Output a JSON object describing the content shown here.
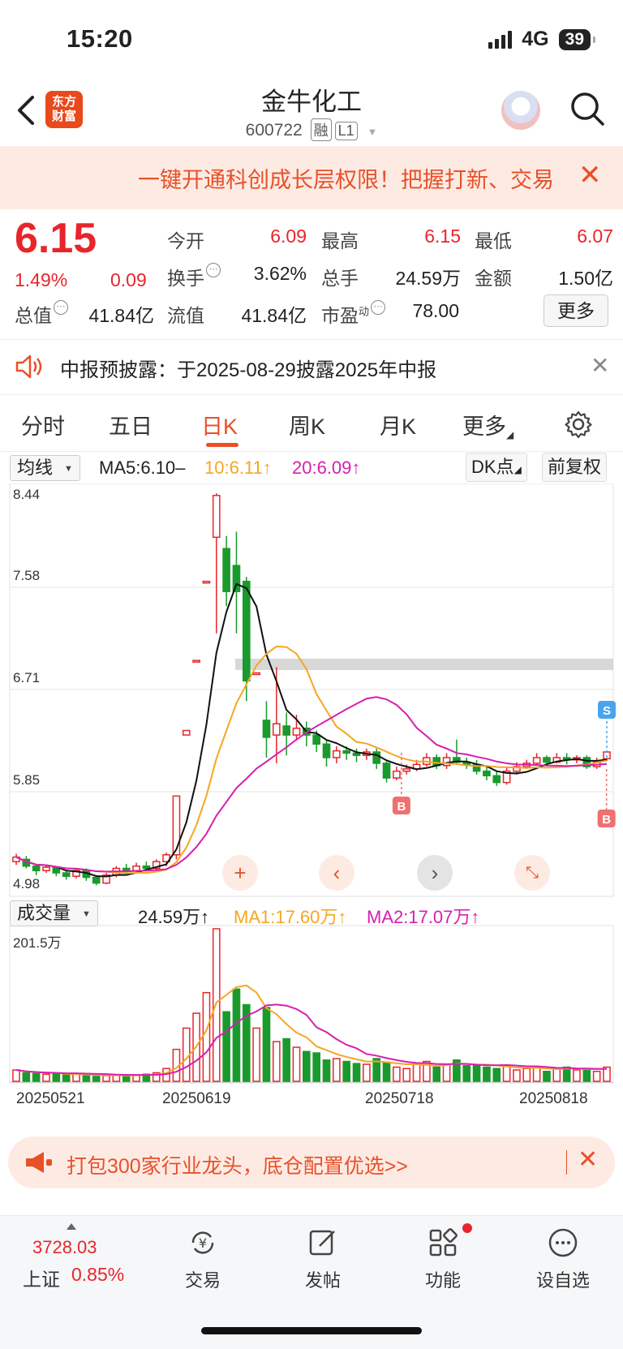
{
  "status": {
    "time": "15:20",
    "network": "4G",
    "battery": "39"
  },
  "header": {
    "logo_line1": "东方",
    "logo_line2": "财富",
    "name": "金牛化工",
    "code": "600722",
    "tag1": "融",
    "tag2": "L1"
  },
  "top_banner": {
    "text": "一键开通科创成长层权限！把握打新、交易",
    "close": "✕"
  },
  "quote": {
    "price": "6.15",
    "change_pct": "1.49%",
    "change_amt": "0.09",
    "open_label": "今开",
    "open": "6.09",
    "high_label": "最高",
    "high": "6.15",
    "low_label": "最低",
    "low": "6.07",
    "turnover_label": "换手",
    "turnover": "3.62%",
    "volume_label": "总手",
    "volume": "24.59万",
    "amount_label": "金额",
    "amount": "1.50亿",
    "mktcap_label": "总值",
    "mktcap": "41.84亿",
    "float_label": "流值",
    "float": "41.84亿",
    "pe_label": "市盈",
    "pe_sup": "动",
    "pe": "78.00",
    "more": "更多"
  },
  "notice": {
    "text": "中报预披露：于2025-08-29披露2025年中报",
    "close": "✕"
  },
  "tabs": [
    "分时",
    "五日",
    "日K",
    "周K",
    "月K",
    "更多"
  ],
  "ma_bar": {
    "selector": "均线",
    "ma5": "MA5:6.10–",
    "ma10": "10:6.11↑",
    "ma20": "20:6.09↑",
    "dk": "DK点",
    "adj": "前复权"
  },
  "vol_bar": {
    "selector": "成交量",
    "vol": "24.59万↑",
    "ma1": "MA1:17.60万↑",
    "ma2": "MA2:17.07万↑"
  },
  "chart_data": {
    "type": "candlestick",
    "y_ticks": [
      "8.44",
      "7.58",
      "6.71",
      "5.85",
      "4.98"
    ],
    "ylim": [
      4.98,
      8.44
    ],
    "vol_max_label": "201.5万",
    "x_labels": [
      "20250521",
      "20250619",
      "20250718",
      "20250818"
    ],
    "markers": [
      "B",
      "B",
      "S"
    ],
    "colors": {
      "up": "#e8252b",
      "down": "#1a9a2c",
      "ma5": "#111111",
      "ma10": "#f5a623",
      "ma20": "#d61fb0"
    }
  },
  "bottom_banner": {
    "text": "打包300家行业龙头，底仓配置优选>>",
    "close": "✕"
  },
  "bottom_nav": {
    "index_value": "3728.03",
    "index_label": "上证",
    "index_pct": "0.85%",
    "trade": "交易",
    "post": "发帖",
    "func": "功能",
    "watch": "设自选"
  }
}
